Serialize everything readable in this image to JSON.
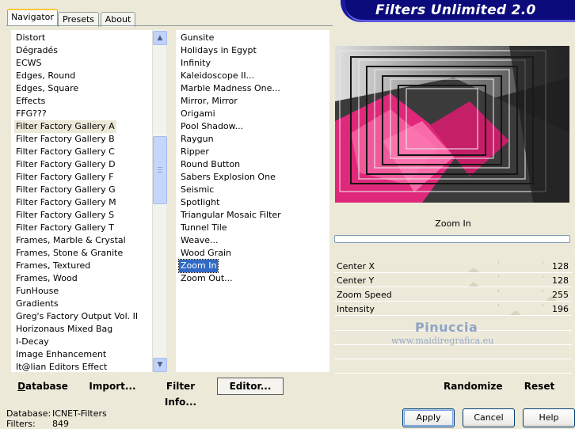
{
  "tabs": [
    {
      "label": "Navigator",
      "active": true
    },
    {
      "label": "Presets",
      "active": false
    },
    {
      "label": "About",
      "active": false
    }
  ],
  "banner": {
    "title": "Filters Unlimited 2.0"
  },
  "categories": {
    "items": [
      "Distort",
      "Dégradés",
      "ECWS",
      "Edges, Round",
      "Edges, Square",
      "Effects",
      "FFG???",
      "Filter Factory Gallery A",
      "Filter Factory Gallery B",
      "Filter Factory Gallery C",
      "Filter Factory Gallery D",
      "Filter Factory Gallery F",
      "Filter Factory Gallery G",
      "Filter Factory Gallery M",
      "Filter Factory Gallery S",
      "Filter Factory Gallery T",
      "Frames, Marble & Crystal",
      "Frames, Stone & Granite",
      "Frames, Textured",
      "Frames, Wood",
      "FunHouse",
      "Gradients",
      "Greg's Factory Output Vol. II",
      "Horizonaus Mixed Bag",
      "I-Decay",
      "Image Enhancement",
      "It@lian Editors Effect"
    ],
    "highlighted_index": 7
  },
  "filters": {
    "items": [
      "Gunsite",
      "Holidays in Egypt",
      "Infinity",
      "Kaleidoscope II...",
      "Marble Madness One...",
      "Mirror, Mirror",
      "Origami",
      "Pool Shadow...",
      "Raygun",
      "Ripper",
      "Round Button",
      "Sabers Explosion One",
      "Seismic",
      "Spotlight",
      "Triangular Mosaic Filter",
      "Tunnel Tile",
      "Weave...",
      "Wood Grain",
      "Zoom In",
      "Zoom Out..."
    ],
    "selected_index": 18
  },
  "preview": {
    "filter_name": "Zoom In",
    "progress": 0
  },
  "params": [
    {
      "label": "Center X",
      "value": "128",
      "fraction": 0.5
    },
    {
      "label": "Center Y",
      "value": "128",
      "fraction": 0.5
    },
    {
      "label": "Zoom Speed",
      "value": "255",
      "fraction": 1.0
    },
    {
      "label": "Intensity",
      "value": "196",
      "fraction": 0.77
    }
  ],
  "watermark": {
    "line1": "Pinuccia",
    "line2": "www.maidiregrafica.eu"
  },
  "toolbar": {
    "database": "Database",
    "import": "Import...",
    "filter_info": "Filter Info...",
    "editor": "Editor...",
    "randomize": "Randomize",
    "reset": "Reset"
  },
  "status": {
    "database_label": "Database:",
    "database_value": "ICNET-Filters",
    "filters_label": "Filters:",
    "filters_value": "849"
  },
  "buttons": {
    "apply": "Apply",
    "cancel": "Cancel",
    "help": "Help"
  },
  "colors": {
    "selection": "#316ac5",
    "banner": "#0b0b7c",
    "pink": "#e0287a"
  }
}
